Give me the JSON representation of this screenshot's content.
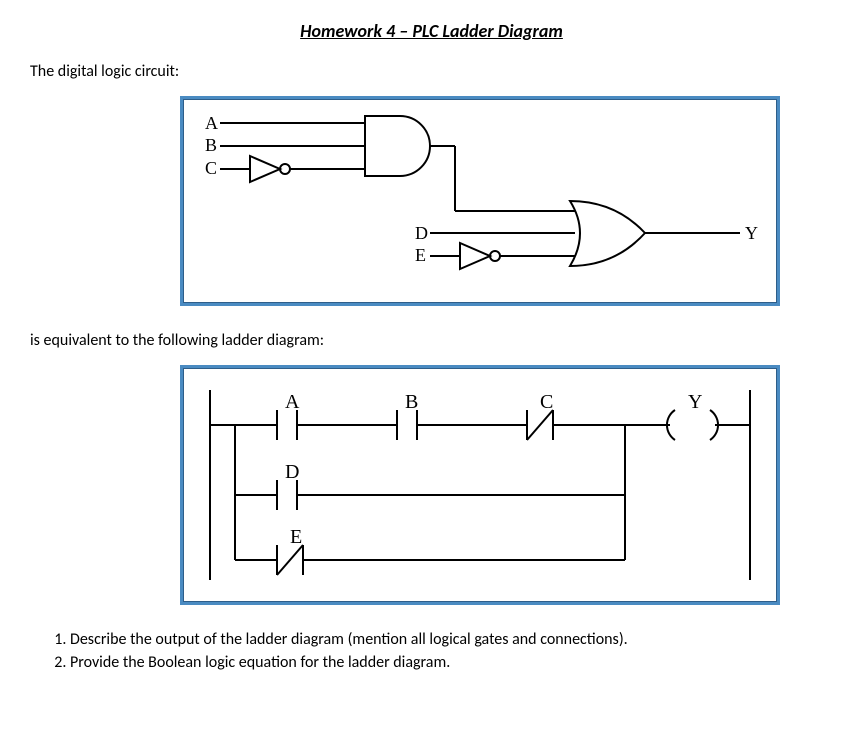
{
  "title": "Homework 4 – PLC Ladder Diagram",
  "intro1": "The digital logic circuit:",
  "intro2": "is equivalent to the following ladder diagram:",
  "logic_labels": {
    "A": "A",
    "B": "B",
    "C": "C",
    "D": "D",
    "E": "E",
    "Y": "Y"
  },
  "ladder_labels": {
    "A": "A",
    "B": "B",
    "C": "C",
    "D": "D",
    "E": "E",
    "Y": "Y"
  },
  "questions": [
    "Describe the output of the ladder diagram (mention all logical gates and connections).",
    "Provide the Boolean logic equation for the ladder diagram."
  ]
}
